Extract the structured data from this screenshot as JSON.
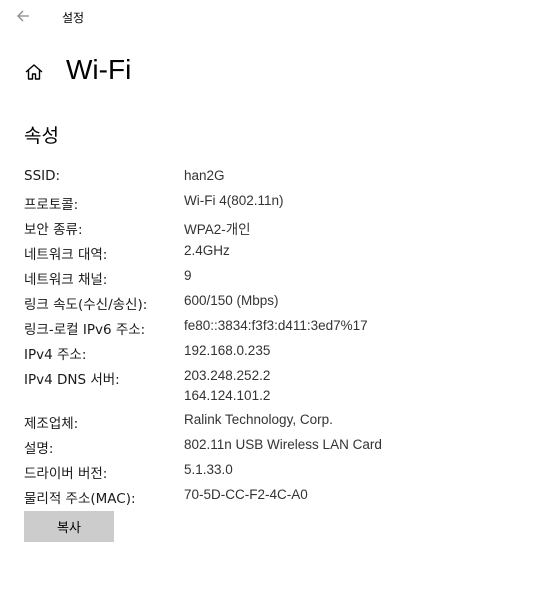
{
  "window": {
    "title": "설정"
  },
  "header": {
    "title": "Wi-Fi"
  },
  "section": {
    "title": "속성"
  },
  "properties": [
    {
      "label": "SSID:",
      "value": "han2G"
    },
    {
      "label": "프로토콜:",
      "value": "Wi-Fi 4(802.11n)"
    },
    {
      "label": "보안 종류:",
      "value": "WPA2-개인"
    },
    {
      "label": "네트워크 대역:",
      "value": "2.4GHz"
    },
    {
      "label": "네트워크 채널:",
      "value": "9"
    },
    {
      "label": "링크 속도(수신/송신):",
      "value": "600/150 (Mbps)"
    },
    {
      "label": "링크-로컬 IPv6 주소:",
      "value": "fe80::3834:f3f3:d411:3ed7%17"
    },
    {
      "label": "IPv4 주소:",
      "value": "192.168.0.235"
    },
    {
      "label": "IPv4 DNS 서버:",
      "value": "203.248.252.2",
      "value2": "164.124.101.2"
    },
    {
      "label": "제조업체:",
      "value": "Ralink Technology, Corp."
    },
    {
      "label": "설명:",
      "value": "802.11n USB Wireless LAN Card"
    },
    {
      "label": "드라이버 버전:",
      "value": "5.1.33.0"
    },
    {
      "label": "물리적 주소(MAC):",
      "value": "70-5D-CC-F2-4C-A0"
    }
  ],
  "copy_button": {
    "label": "복사"
  },
  "icons": {
    "back": "back-arrow-icon",
    "home": "home-icon"
  }
}
